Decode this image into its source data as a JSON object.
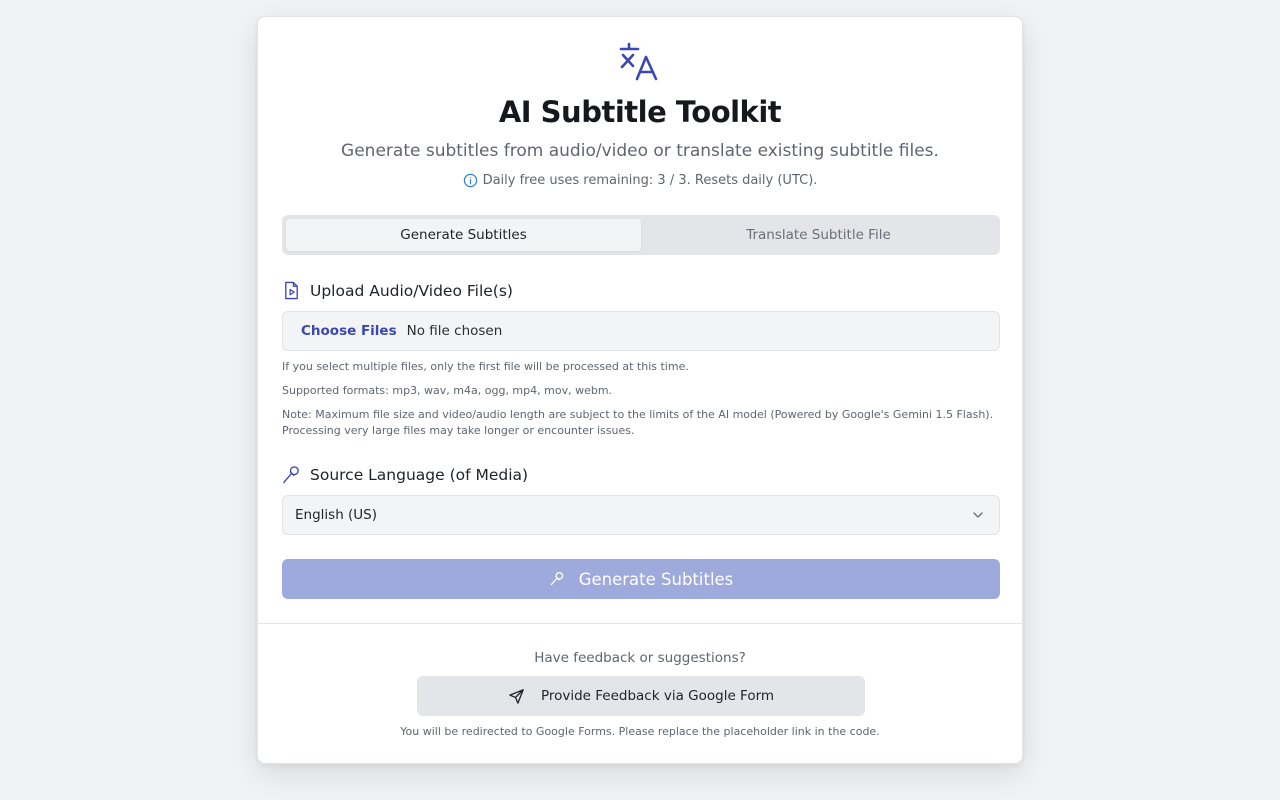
{
  "app": {
    "title": "AI Subtitle Toolkit",
    "subtitle": "Generate subtitles from audio/video or translate existing subtitle files.",
    "usage_text": "Daily free uses remaining: 3 / 3. Resets daily (UTC).",
    "logo_icon": "translate-icon",
    "accent_color": "#3b47b3"
  },
  "tabs": [
    {
      "label": "Generate Subtitles",
      "active": true
    },
    {
      "label": "Translate Subtitle File",
      "active": false
    }
  ],
  "upload": {
    "label": "Upload Audio/Video File(s)",
    "icon": "file-video-icon",
    "choose_label": "Choose Files",
    "status": "No file chosen",
    "hints": [
      "If you select multiple files, only the first file will be processed at this time.",
      "Supported formats: mp3, wav, m4a, ogg, mp4, mov, webm.",
      "Note: Maximum file size and video/audio length are subject to the limits of the AI model (Powered by Google's Gemini 1.5 Flash). Processing very large files may take longer or encounter issues."
    ]
  },
  "language": {
    "label": "Source Language (of Media)",
    "icon": "microphone-icon",
    "selected": "English (US)"
  },
  "generate_button": {
    "label": "Generate Subtitles",
    "disabled_color": "#9ea9dc"
  },
  "feedback": {
    "question": "Have feedback or suggestions?",
    "button_label": "Provide Feedback via Google Form",
    "note": "You will be redirected to Google Forms. Please replace the placeholder link in the code."
  }
}
